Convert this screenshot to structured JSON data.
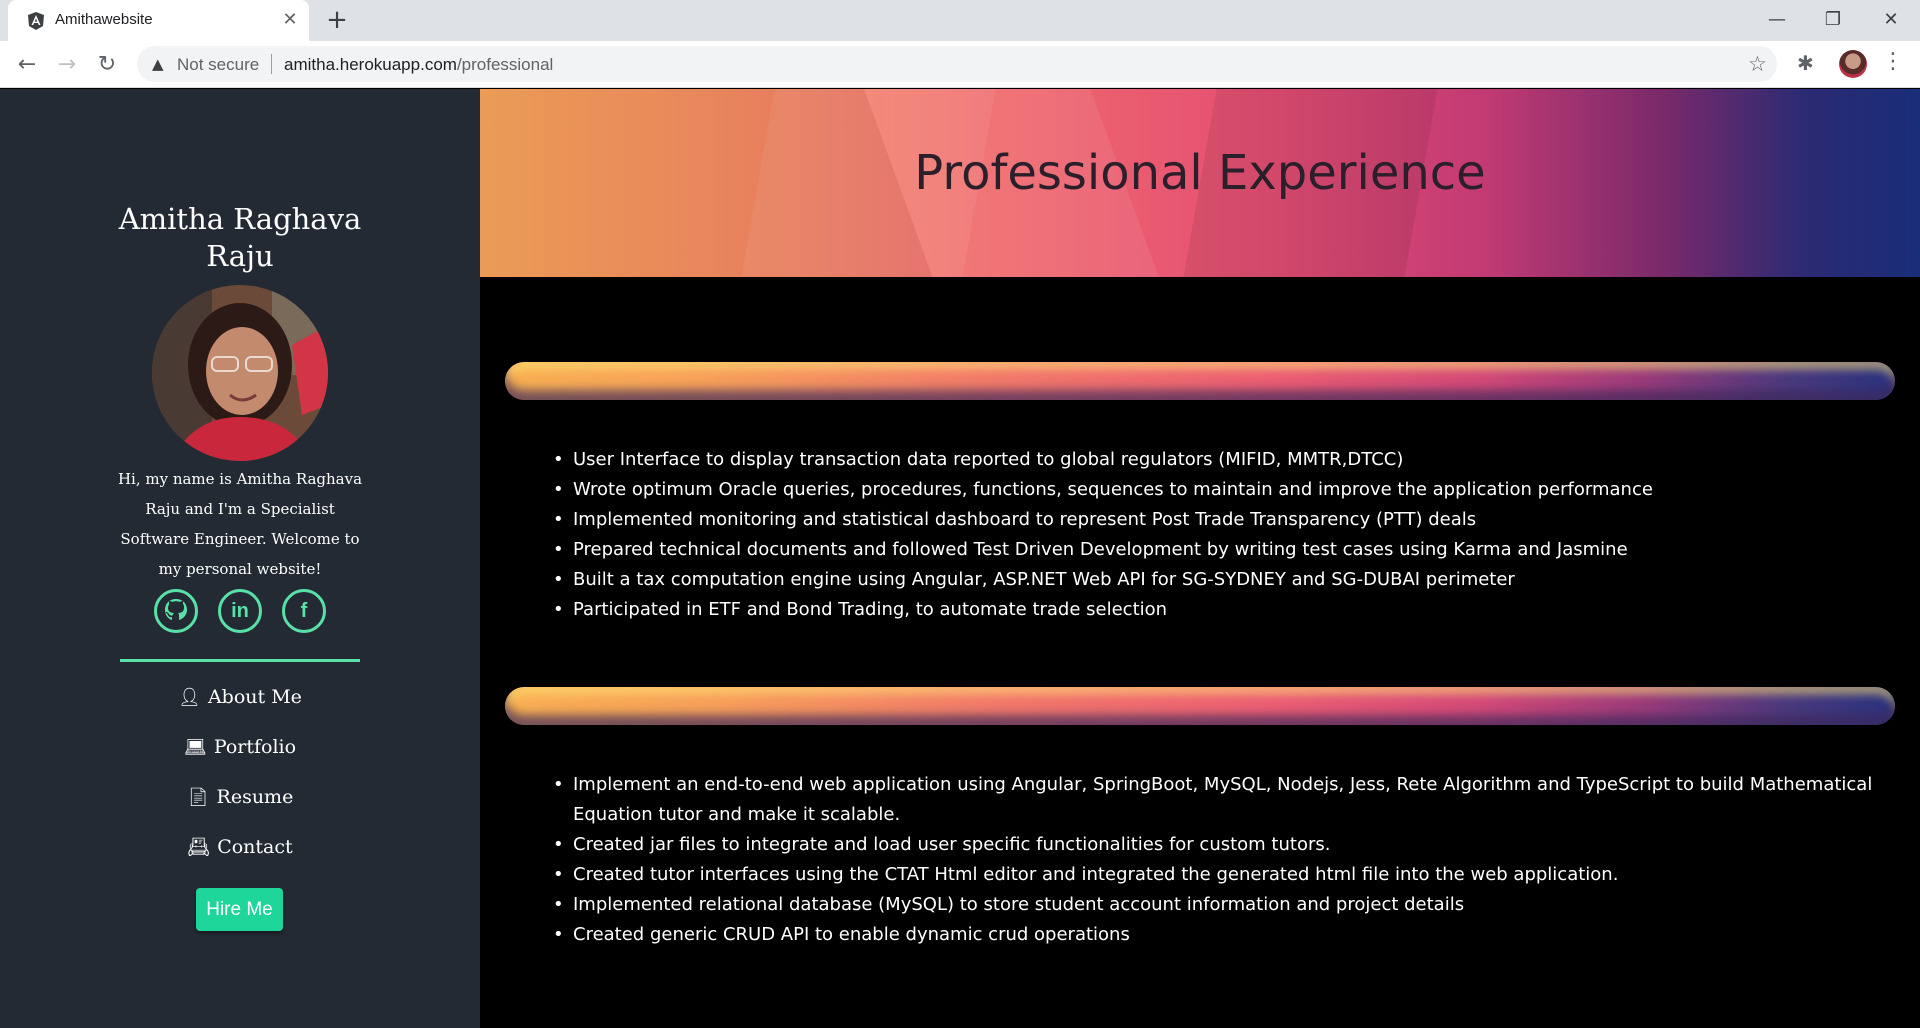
{
  "browser": {
    "tab_title": "Amithawebsite",
    "url_host": "amitha.herokuapp.com",
    "url_path": "/professional",
    "security_label": "Not secure"
  },
  "sidebar": {
    "name_line1": "Amitha Raghava",
    "name_line2": "Raju",
    "intro": "Hi, my name is Amitha Raghava Raju and I'm a Specialist Software Engineer. Welcome to my personal website!",
    "socials": [
      {
        "name": "github",
        "glyph": "Ⓖ"
      },
      {
        "name": "linkedin",
        "glyph": "in"
      },
      {
        "name": "facebook",
        "glyph": "f"
      }
    ],
    "nav": [
      {
        "label": "About Me",
        "icon": "user-icon"
      },
      {
        "label": "Portfolio",
        "icon": "laptop-icon"
      },
      {
        "label": "Resume",
        "icon": "file-icon"
      },
      {
        "label": "Contact",
        "icon": "contact-card-icon"
      }
    ],
    "hire_label": "Hire Me",
    "accent_color": "#58e1a7",
    "button_color": "#1fd69a"
  },
  "main": {
    "page_title": "Professional Experience",
    "experiences": [
      {
        "bullets": [
          "User Interface to display transaction data reported to global regulators (MIFID, MMTR,DTCC)",
          "Wrote optimum Oracle queries, procedures, functions, sequences to maintain and improve the application performance",
          "Implemented monitoring and statistical dashboard to represent Post Trade Transparency (PTT) deals",
          "Prepared technical documents and followed Test Driven Development by writing test cases using Karma and Jasmine",
          "Built a tax computation engine using Angular, ASP.NET Web API for SG-SYDNEY and SG-DUBAI perimeter",
          "Participated in ETF and Bond Trading, to automate trade selection"
        ]
      },
      {
        "bullets": [
          "Implement an end-to-end web application using Angular, SpringBoot, MySQL, Nodejs, Jess, Rete Algorithm and TypeScript to build Mathematical Equation tutor and make it scalable.",
          "Created jar files to integrate and load user specific functionalities for custom tutors.",
          "Created tutor interfaces using the CTAT Html editor and integrated the generated html file into the web application.",
          "Implemented relational database (MySQL) to store student account information and project details",
          "Created generic CRUD API to enable dynamic crud operations"
        ]
      }
    ]
  }
}
